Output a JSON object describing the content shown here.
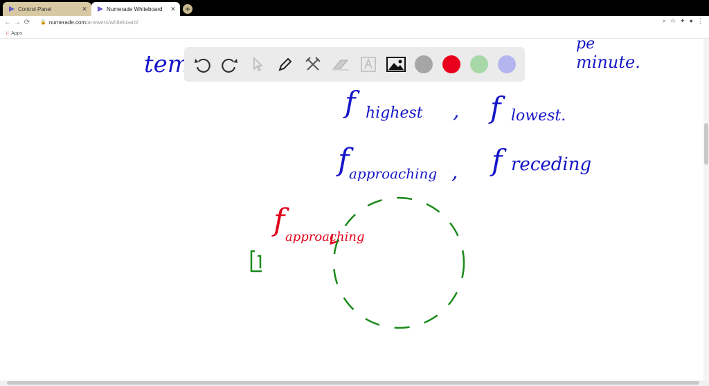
{
  "browser": {
    "tabs": [
      {
        "title": "Control Panel",
        "active": false
      },
      {
        "title": "Numerade Whiteboard",
        "active": true
      }
    ],
    "url_host": "numerade.com",
    "url_path": "/answers/whiteboard/",
    "bookmarks_label": "Apps"
  },
  "whiteboard": {
    "tools": [
      "undo-icon",
      "redo-icon",
      "pointer-icon",
      "pen-icon",
      "tools-icon",
      "eraser-icon",
      "text-icon",
      "image-icon"
    ],
    "colors": [
      "#a6a6a6",
      "#e8001c",
      "#a8d8a8",
      "#b4b4f0"
    ],
    "handwriting": {
      "line1_left": "tem",
      "line1_right_top": "pe",
      "line1_right": "minute.",
      "line2_left": "f",
      "line2_left_sub": "highest",
      "line2_right": "f",
      "line2_right_sub": "lowest.",
      "line3_left": "f",
      "line3_left_sub": "approaching",
      "line3_right": "f",
      "line3_right_sub": "receding",
      "red_f": "f",
      "red_sub": "approaching"
    }
  }
}
